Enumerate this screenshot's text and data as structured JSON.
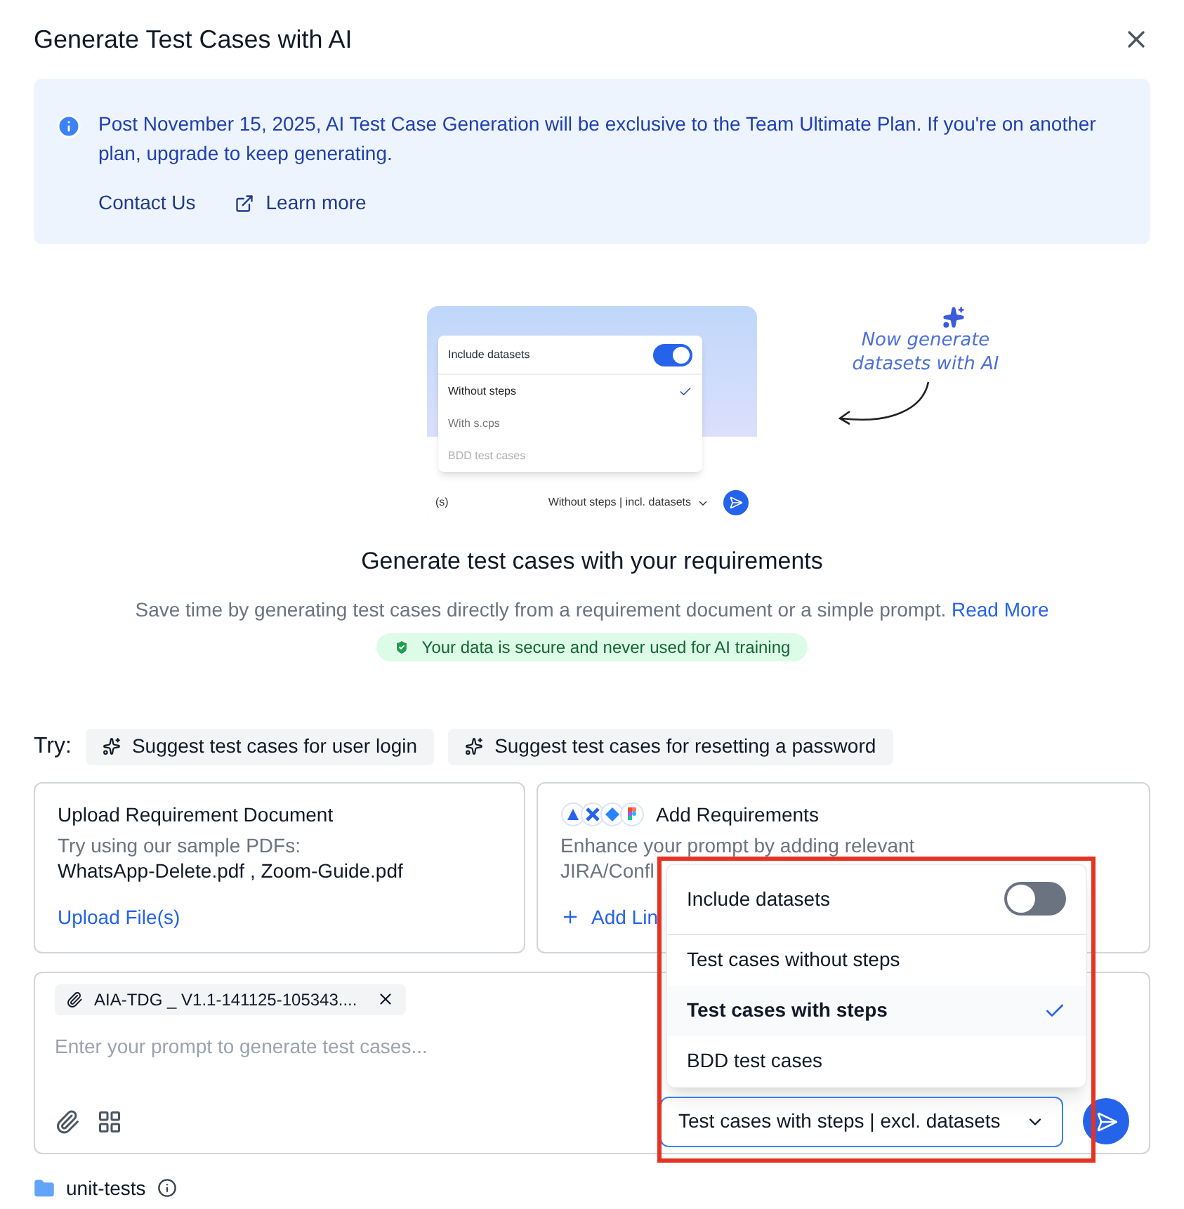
{
  "dialog": {
    "title": "Generate Test Cases with AI"
  },
  "notice": {
    "text": "Post November 15, 2025, AI Test Case Generation will be exclusive to the Team Ultimate Plan. If you're on another plan, upgrade to keep generating.",
    "contact": "Contact Us",
    "learn_more": "Learn more"
  },
  "illustration": {
    "toggle_label": "Include datasets",
    "toggle_on": true,
    "options": [
      {
        "label": "Without steps",
        "selected": true
      },
      {
        "label": "With s.cps",
        "selected": false
      },
      {
        "label": "BDD test cases",
        "selected": false
      }
    ],
    "left_fragment": "(s)",
    "select_value": "Without steps | incl. datasets",
    "caption": "Now generate datasets with AI"
  },
  "hero": {
    "heading": "Generate test cases with your requirements",
    "description": "Save time by generating test cases directly from a requirement document or a simple prompt.",
    "read_more": "Read More",
    "secure_badge": "Your data is secure and never used for AI training"
  },
  "try": {
    "label": "Try:",
    "suggestions": [
      "Suggest test cases for user login",
      "Suggest test cases for resetting a password"
    ]
  },
  "cards": [
    {
      "kind": "upload",
      "title": "Upload Requirement Document",
      "lines": [
        "Try using our sample PDFs:",
        "WhatsApp-Delete.pdf , Zoom-Guide.pdf"
      ],
      "action": "Upload File(s)"
    },
    {
      "kind": "integrations",
      "title": "Add Requirements",
      "lines": [
        "Enhance your prompt by adding relevant",
        "JIRA/Confl"
      ],
      "action": "Add Lin"
    }
  ],
  "prompt": {
    "attachment": "AIA-TDG _ V1.1-141125-105343....",
    "placeholder": "Enter your prompt to generate test cases...",
    "mode_select": "Test cases with steps | excl. datasets"
  },
  "mode_menu": {
    "toggle_label": "Include datasets",
    "toggle_on": false,
    "options": [
      {
        "label": "Test cases without steps",
        "selected": false
      },
      {
        "label": "Test cases with steps",
        "selected": true
      },
      {
        "label": "BDD test cases",
        "selected": false
      }
    ]
  },
  "folder": {
    "name": "unit-tests"
  }
}
